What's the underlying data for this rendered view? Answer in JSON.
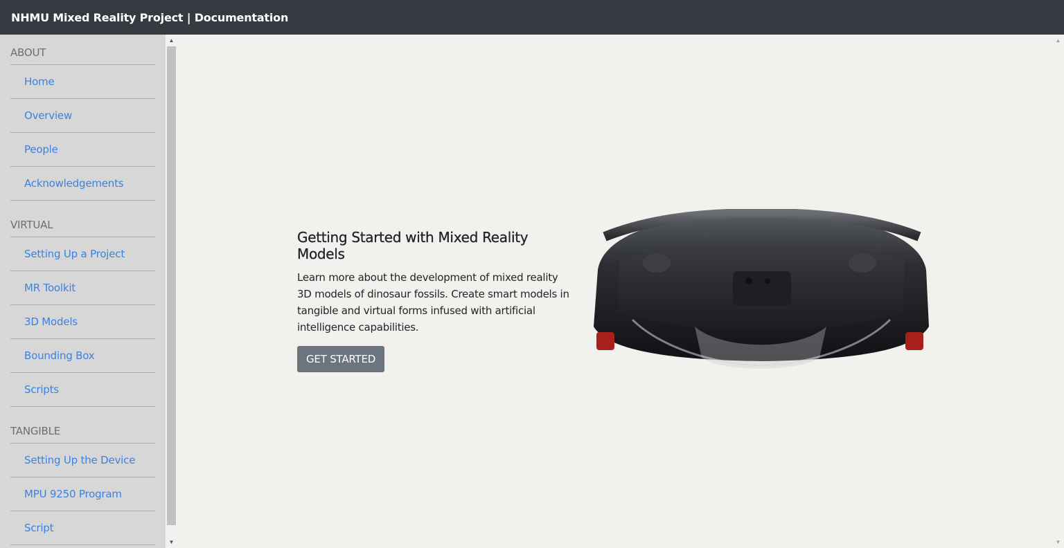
{
  "header": {
    "title": "NHMU Mixed Reality Project | Documentation"
  },
  "sidebar": {
    "sections": [
      {
        "title": "ABOUT",
        "items": [
          "Home",
          "Overview",
          "People",
          "Acknowledgements"
        ]
      },
      {
        "title": "VIRTUAL",
        "items": [
          "Setting Up a Project",
          "MR Toolkit",
          "3D Models",
          "Bounding Box",
          "Scripts"
        ]
      },
      {
        "title": "TANGIBLE",
        "items": [
          "Setting Up the Device",
          "MPU 9250 Program",
          "Script"
        ]
      }
    ]
  },
  "hero": {
    "heading": "Getting Started with Mixed Reality Models",
    "body": "Learn more about the development of mixed reality 3D models of dinosaur fossils. Create smart models in tangible and virtual forms infused with artificial intelligence capabilities.",
    "button_label": "GET STARTED"
  },
  "colors": {
    "topbar": "#343a40",
    "sidebar": "#d7d7d7",
    "link": "#3b82e0",
    "button": "#6c757d",
    "background": "#f2f1ee"
  },
  "icons": {
    "scroll_up": "triangle-up",
    "scroll_down": "triangle-down"
  }
}
